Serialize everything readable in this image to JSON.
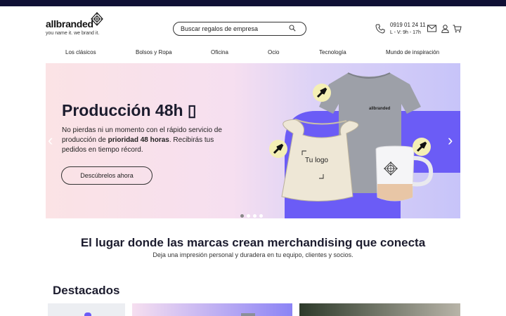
{
  "brand": {
    "name": "allbranded",
    "tagline": "you name it. we brand it.",
    "logo_icon": "crosshair-diamond-icon"
  },
  "search": {
    "placeholder": "Buscar regalos de empresa",
    "icon": "search-icon"
  },
  "contact": {
    "phone": "0919 01 24 11",
    "hours": "L - V: 9h - 17h"
  },
  "header_icons": [
    "phone-icon",
    "mail-icon",
    "user-icon",
    "cart-icon"
  ],
  "nav": {
    "items": [
      {
        "label": "Los clásicos"
      },
      {
        "label": "Bolsos y Ropa"
      },
      {
        "label": "Oficina"
      },
      {
        "label": "Ocio"
      },
      {
        "label": "Tecnología"
      },
      {
        "label": "Mundo de inspiración"
      }
    ]
  },
  "hero": {
    "title": "Producción 48h ▯",
    "text_a": "No pierdas ni un momento con el rápido servicio de producción de ",
    "text_bold": "prioridad 48 horas",
    "text_b": ". Recibirás tus pedidos en tiempo récord.",
    "button": "Descúbrelos ahora",
    "bag_text": "Tu logo",
    "shirt_text": "allbranded",
    "slides": 4,
    "active_slide": 1,
    "accent": "#6b5cf6"
  },
  "intro": {
    "heading": "El lugar donde las marcas crean merchandising que conecta",
    "subheading": "Deja una impresión personal y duradera en tu equipo, clientes y socios."
  },
  "featured": {
    "title": "Destacados"
  }
}
